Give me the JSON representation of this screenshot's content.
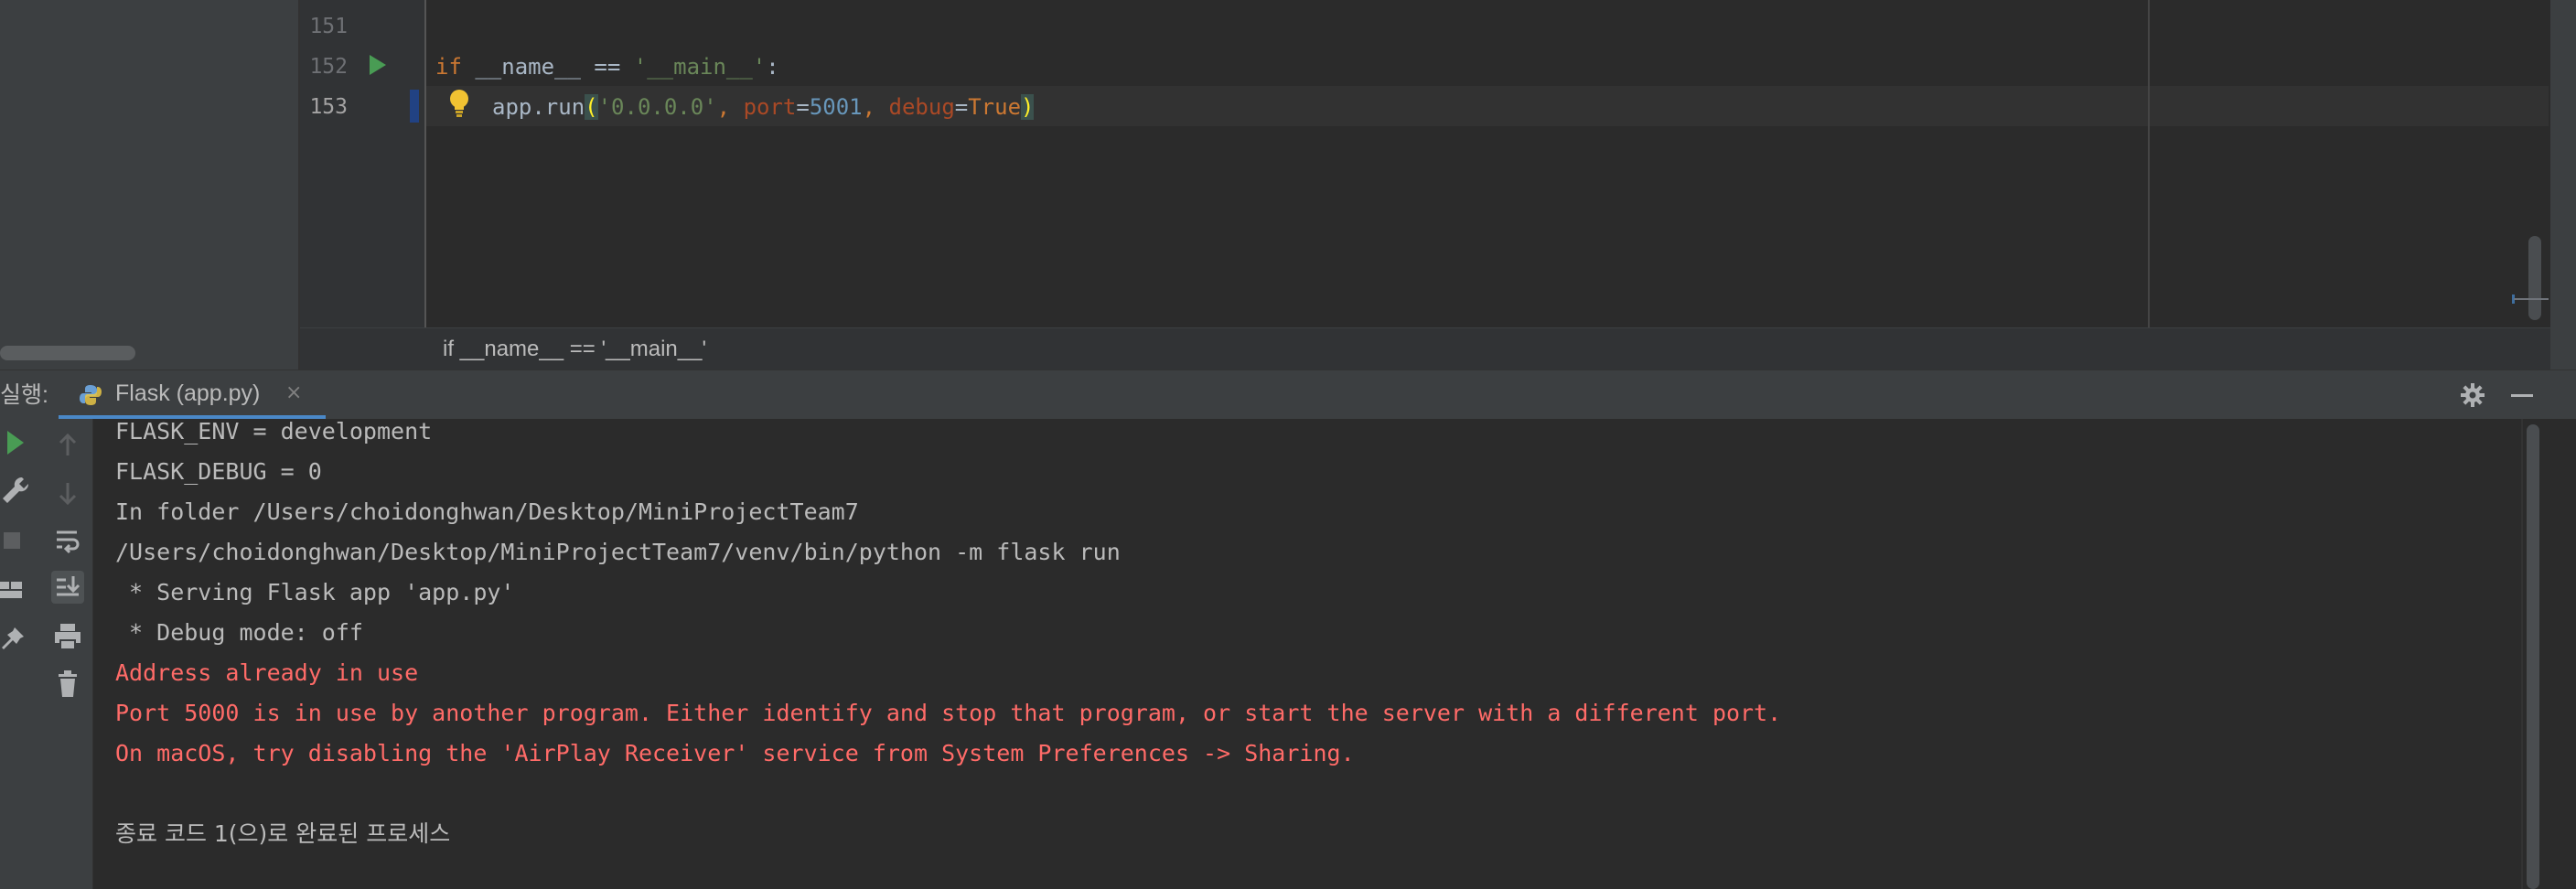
{
  "editor": {
    "lines": [
      {
        "number": "151",
        "code": ""
      },
      {
        "number": "152",
        "code": "if __name__ == '__main__':"
      },
      {
        "number": "153",
        "code": "    app.run('0.0.0.0', port=5001, debug=True)"
      }
    ],
    "tokens": {
      "line152": {
        "kw_if": "if",
        "name": " __name__ ",
        "eq": "==",
        "space": " ",
        "str_main": "'__main__'",
        "colon": ":"
      },
      "line153": {
        "call": "app.run",
        "open": "(",
        "str_ip": "'0.0.0.0'",
        "comma1": ", ",
        "port_kw": "port",
        "eq1": "=",
        "port_val": "5001",
        "comma2": ", ",
        "debug_kw": "debug",
        "eq2": "=",
        "debug_val": "True",
        "close": ")"
      }
    },
    "breadcrumb": "if __name__ == '__main__'"
  },
  "run_panel": {
    "title": "실행:",
    "tab_label": "Flask (app.py)",
    "tab_close": "×"
  },
  "console": {
    "lines": [
      {
        "text": "FLASK_ENV = development",
        "type": "normal"
      },
      {
        "text": "FLASK_DEBUG = 0",
        "type": "normal"
      },
      {
        "text": "In folder /Users/choidonghwan/Desktop/MiniProjectTeam7",
        "type": "normal"
      },
      {
        "text": "/Users/choidonghwan/Desktop/MiniProjectTeam7/venv/bin/python -m flask run",
        "type": "normal"
      },
      {
        "text": " * Serving Flask app 'app.py'",
        "type": "normal"
      },
      {
        "text": " * Debug mode: off",
        "type": "normal"
      },
      {
        "text": "Address already in use",
        "type": "error"
      },
      {
        "text": "Port 5000 is in use by another program. Either identify and stop that program, or start the server with a different port.",
        "type": "error"
      },
      {
        "text": "On macOS, try disabling the 'AirPlay Receiver' service from System Preferences -> Sharing.",
        "type": "error"
      },
      {
        "text": "",
        "type": "normal"
      },
      {
        "text": "종료 코드 1(으)로 완료된 프로세스",
        "type": "normal"
      }
    ]
  },
  "colors": {
    "background": "#2b2b2b",
    "panel": "#3c3f41",
    "keyword": "#cc7832",
    "string": "#6a8759",
    "number": "#6897bb",
    "error_text": "#ff6b68",
    "run_green": "#499c54",
    "tab_underline": "#4a88c7"
  },
  "icons": {
    "run_gutter": "play-icon",
    "bulb": "lightbulb-icon",
    "python": "python-icon",
    "settings": "gear-icon",
    "minimize": "minimize-icon"
  }
}
